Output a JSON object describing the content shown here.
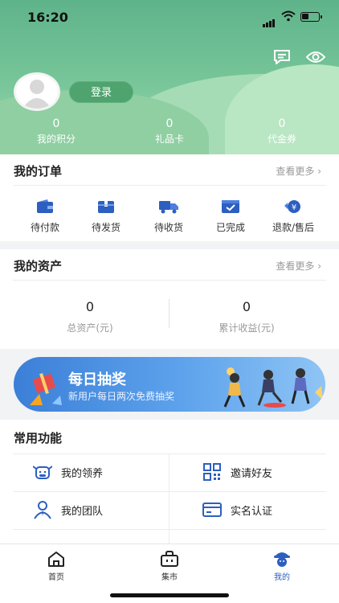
{
  "status": {
    "time": "16:20"
  },
  "profile": {
    "login_label": "登录",
    "stats": [
      {
        "value": "0",
        "label": "我的积分"
      },
      {
        "value": "0",
        "label": "礼品卡"
      },
      {
        "value": "0",
        "label": "代金券"
      }
    ]
  },
  "orders": {
    "title": "我的订单",
    "more": "查看更多",
    "items": [
      {
        "label": "待付款",
        "icon": "wallet-icon"
      },
      {
        "label": "待发货",
        "icon": "package-icon"
      },
      {
        "label": "待收货",
        "icon": "truck-icon"
      },
      {
        "label": "已完成",
        "icon": "completed-icon"
      },
      {
        "label": "退款/售后",
        "icon": "refund-icon"
      }
    ]
  },
  "assets": {
    "title": "我的资产",
    "more": "查看更多",
    "items": [
      {
        "value": "0",
        "label": "总资产(元)"
      },
      {
        "value": "0",
        "label": "累计收益(元)"
      }
    ]
  },
  "banner": {
    "title": "每日抽奖",
    "subtitle": "新用户每日两次免费抽奖"
  },
  "functions": {
    "title": "常用功能",
    "items": [
      {
        "label": "我的领养",
        "icon": "cow-icon"
      },
      {
        "label": "邀请好友",
        "icon": "qr-code-icon"
      },
      {
        "label": "我的团队",
        "icon": "team-icon"
      },
      {
        "label": "实名认证",
        "icon": "id-card-icon"
      }
    ]
  },
  "tabbar": {
    "items": [
      {
        "label": "首页",
        "icon": "home-icon"
      },
      {
        "label": "集市",
        "icon": "market-icon"
      },
      {
        "label": "我的",
        "icon": "profile-icon"
      }
    ],
    "active": "我的"
  },
  "colors": {
    "header_green": "#6dbb90",
    "accent_blue": "#2d5fc0",
    "login_button": "#4fa36e"
  }
}
